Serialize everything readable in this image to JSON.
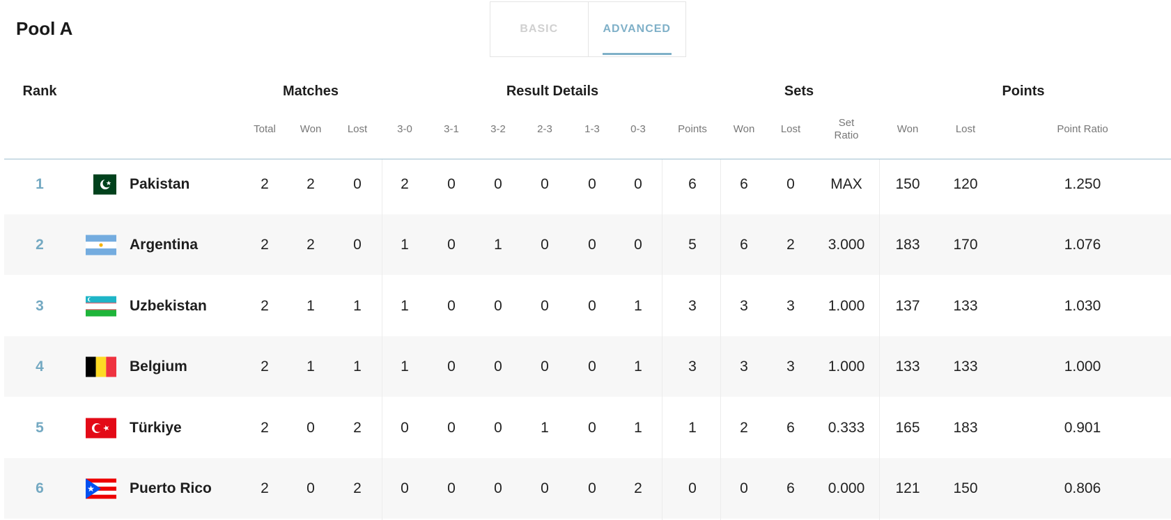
{
  "pool": {
    "title": "Pool A"
  },
  "tabs": [
    {
      "label": "BASIC",
      "active": false
    },
    {
      "label": "ADVANCED",
      "active": true
    }
  ],
  "group_headers": {
    "rank": "Rank",
    "matches": "Matches",
    "result_details": "Result Details",
    "sets": "Sets",
    "points": "Points"
  },
  "sub_headers": {
    "total": "Total",
    "won": "Won",
    "lost": "Lost",
    "r30": "3-0",
    "r31": "3-1",
    "r32": "3-2",
    "r23": "2-3",
    "r13": "1-3",
    "r03": "0-3",
    "points": "Points",
    "sets_won": "Won",
    "sets_lost": "Lost",
    "set_ratio": "Set\nRatio",
    "points_won": "Won",
    "points_lost": "Lost",
    "point_ratio": "Point Ratio"
  },
  "colors": {
    "accent": "#74a9c2",
    "tab_inactive": "#d0d0d0",
    "row_alt": "#f7f7f7"
  },
  "rows": [
    {
      "rank": "1",
      "flag": "pakistan-flag-icon",
      "team": "Pakistan",
      "total": "2",
      "won": "2",
      "lost": "0",
      "r30": "2",
      "r31": "0",
      "r32": "0",
      "r23": "0",
      "r13": "0",
      "r03": "0",
      "points": "6",
      "sets_won": "6",
      "sets_lost": "0",
      "set_ratio": "MAX",
      "points_won": "150",
      "points_lost": "120",
      "point_ratio": "1.250"
    },
    {
      "rank": "2",
      "flag": "argentina-flag-icon",
      "team": "Argentina",
      "total": "2",
      "won": "2",
      "lost": "0",
      "r30": "1",
      "r31": "0",
      "r32": "1",
      "r23": "0",
      "r13": "0",
      "r03": "0",
      "points": "5",
      "sets_won": "6",
      "sets_lost": "2",
      "set_ratio": "3.000",
      "points_won": "183",
      "points_lost": "170",
      "point_ratio": "1.076"
    },
    {
      "rank": "3",
      "flag": "uzbekistan-flag-icon",
      "team": "Uzbekistan",
      "total": "2",
      "won": "1",
      "lost": "1",
      "r30": "1",
      "r31": "0",
      "r32": "0",
      "r23": "0",
      "r13": "0",
      "r03": "1",
      "points": "3",
      "sets_won": "3",
      "sets_lost": "3",
      "set_ratio": "1.000",
      "points_won": "137",
      "points_lost": "133",
      "point_ratio": "1.030"
    },
    {
      "rank": "4",
      "flag": "belgium-flag-icon",
      "team": "Belgium",
      "total": "2",
      "won": "1",
      "lost": "1",
      "r30": "1",
      "r31": "0",
      "r32": "0",
      "r23": "0",
      "r13": "0",
      "r03": "1",
      "points": "3",
      "sets_won": "3",
      "sets_lost": "3",
      "set_ratio": "1.000",
      "points_won": "133",
      "points_lost": "133",
      "point_ratio": "1.000"
    },
    {
      "rank": "5",
      "flag": "turkiye-flag-icon",
      "team": "Türkiye",
      "total": "2",
      "won": "0",
      "lost": "2",
      "r30": "0",
      "r31": "0",
      "r32": "0",
      "r23": "1",
      "r13": "0",
      "r03": "1",
      "points": "1",
      "sets_won": "2",
      "sets_lost": "6",
      "set_ratio": "0.333",
      "points_won": "165",
      "points_lost": "183",
      "point_ratio": "0.901"
    },
    {
      "rank": "6",
      "flag": "puerto-rico-flag-icon",
      "team": "Puerto Rico",
      "total": "2",
      "won": "0",
      "lost": "2",
      "r30": "0",
      "r31": "0",
      "r32": "0",
      "r23": "0",
      "r13": "0",
      "r03": "2",
      "points": "0",
      "sets_won": "0",
      "sets_lost": "6",
      "set_ratio": "0.000",
      "points_won": "121",
      "points_lost": "150",
      "point_ratio": "0.806"
    }
  ]
}
